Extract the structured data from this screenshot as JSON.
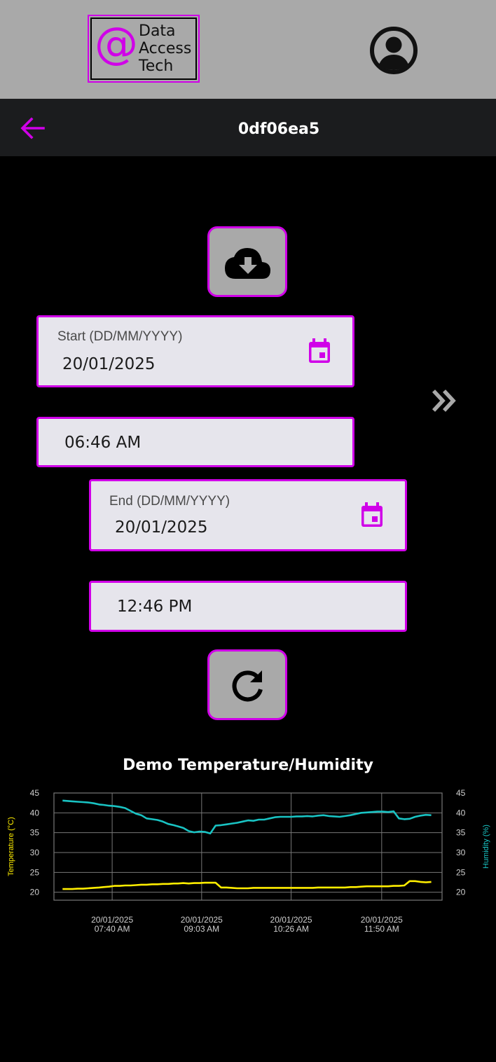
{
  "header": {
    "logo": {
      "symbol": "@",
      "lines": [
        "Data",
        "Access",
        "Tech"
      ]
    },
    "avatar_icon": "account-circle-icon"
  },
  "nav": {
    "back_icon": "arrow-left-icon",
    "title": "0df06ea5"
  },
  "actions": {
    "download_icon": "cloud-download-icon",
    "refresh_icon": "refresh-icon"
  },
  "form": {
    "start_date": {
      "label": "Start (DD/MM/YYYY)",
      "value": "20/01/2025",
      "icon": "calendar-icon"
    },
    "start_time": {
      "value": "06:46 AM"
    },
    "end_date": {
      "label": "End (DD/MM/YYYY)",
      "value": "20/01/2025",
      "icon": "calendar-icon"
    },
    "end_time": {
      "value": "12:46 PM"
    },
    "expand_icon": "double-chevron-right-icon"
  },
  "colors": {
    "accent": "#d000e8",
    "header_bg": "#a9a9a9",
    "nav_bg": "#1b1c1e",
    "field_bg": "#e6e5ec",
    "temperature": "#ffee00",
    "humidity": "#19c3c3"
  },
  "chart_data": {
    "type": "line",
    "title": "Demo Temperature/Humidity",
    "ylabel_left": "Temperature (°C)",
    "ylabel_right": "Humidity (%)",
    "ylim": [
      18,
      45
    ],
    "yticks": [
      20,
      25,
      30,
      35,
      40,
      45
    ],
    "xlim": [
      "20/01/2025 06:46",
      "20/01/2025 12:46"
    ],
    "xticks": [
      {
        "date": "20/01/2025",
        "time": "07:40 AM"
      },
      {
        "date": "20/01/2025",
        "time": "09:03 AM"
      },
      {
        "date": "20/01/2025",
        "time": "10:26 AM"
      },
      {
        "date": "20/01/2025",
        "time": "11:50 AM"
      }
    ],
    "grid": true,
    "x": [
      "06:54",
      "07:03",
      "07:08",
      "07:13",
      "07:18",
      "07:23",
      "07:28",
      "07:32",
      "07:37",
      "07:42",
      "07:47",
      "07:52",
      "07:57",
      "08:02",
      "08:07",
      "08:12",
      "08:17",
      "08:22",
      "08:27",
      "08:32",
      "08:37",
      "08:41",
      "08:46",
      "08:51",
      "08:56",
      "09:01",
      "09:06",
      "09:11",
      "09:16",
      "09:21",
      "09:26",
      "09:31",
      "09:36",
      "09:41",
      "09:46",
      "09:51",
      "09:56",
      "10:01",
      "10:06",
      "10:11",
      "10:16",
      "10:21",
      "10:26",
      "10:31",
      "10:36",
      "10:41",
      "10:46",
      "10:51",
      "10:56",
      "11:01",
      "11:06",
      "11:11",
      "11:16",
      "11:21",
      "11:26",
      "11:31",
      "11:36",
      "11:41",
      "11:46",
      "11:51",
      "11:56",
      "12:01",
      "12:06",
      "12:11",
      "12:16",
      "12:21",
      "12:26",
      "12:31",
      "12:36"
    ],
    "series": [
      {
        "name": "Temperature",
        "axis": "left",
        "color": "#ffee00",
        "values": [
          20.8,
          20.8,
          20.9,
          20.9,
          21.0,
          21.1,
          21.2,
          21.3,
          21.4,
          21.6,
          21.6,
          21.7,
          21.7,
          21.8,
          21.9,
          21.9,
          22.0,
          22.0,
          22.1,
          22.1,
          22.2,
          22.2,
          22.3,
          22.2,
          22.3,
          22.3,
          22.4,
          22.4,
          22.4,
          21.2,
          21.2,
          21.1,
          21.0,
          21.0,
          21.0,
          21.1,
          21.1,
          21.1,
          21.1,
          21.1,
          21.1,
          21.1,
          21.1,
          21.1,
          21.1,
          21.1,
          21.1,
          21.2,
          21.2,
          21.2,
          21.2,
          21.2,
          21.2,
          21.3,
          21.3,
          21.4,
          21.5,
          21.5,
          21.5,
          21.5,
          21.5,
          21.6,
          21.6,
          21.7,
          22.8,
          22.8,
          22.6,
          22.5,
          22.6
        ]
      },
      {
        "name": "Humidity",
        "axis": "right",
        "color": "#19c3c3",
        "values": [
          43.1,
          42.9,
          42.8,
          42.7,
          42.6,
          42.4,
          42.1,
          42.0,
          41.8,
          41.7,
          41.5,
          41.2,
          40.5,
          39.8,
          39.4,
          38.6,
          38.4,
          38.2,
          37.8,
          37.2,
          36.9,
          36.6,
          36.2,
          35.4,
          35.1,
          35.3,
          35.2,
          34.8,
          36.8,
          36.9,
          37.1,
          37.3,
          37.5,
          37.8,
          38.1,
          38.0,
          38.3,
          38.3,
          38.6,
          38.9,
          39.0,
          39.0,
          39.0,
          39.1,
          39.1,
          39.2,
          39.1,
          39.3,
          39.4,
          39.2,
          39.1,
          39.0,
          39.2,
          39.4,
          39.7,
          40.0,
          40.1,
          40.2,
          40.3,
          40.3,
          40.2,
          40.4,
          38.6,
          38.4,
          38.5,
          39.0,
          39.3,
          39.5,
          39.4
        ]
      }
    ]
  }
}
